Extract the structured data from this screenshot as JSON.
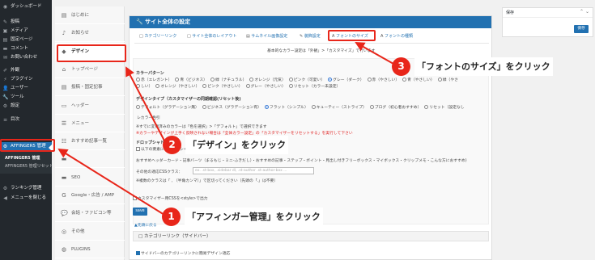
{
  "wp_menu": {
    "items": [
      {
        "label": "ダッシュボード",
        "icon": "dashboard-icon",
        "glyph": "◉"
      },
      {
        "label": "投稿",
        "icon": "pin-icon",
        "glyph": "✎"
      },
      {
        "label": "メディア",
        "icon": "media-icon",
        "glyph": "▣"
      },
      {
        "label": "固定ページ",
        "icon": "page-icon",
        "glyph": "▤"
      },
      {
        "label": "コメント",
        "icon": "comment-icon",
        "glyph": "▬"
      },
      {
        "label": "お問い合わせ",
        "icon": "mail-icon",
        "glyph": "✉"
      },
      {
        "label": "外観",
        "icon": "brush-icon",
        "glyph": "✐"
      },
      {
        "label": "プラグイン",
        "icon": "plugin-icon",
        "glyph": "⚡"
      },
      {
        "label": "ユーザー",
        "icon": "user-icon",
        "glyph": "👤"
      },
      {
        "label": "ツール",
        "icon": "wrench-icon",
        "glyph": "🔧"
      },
      {
        "label": "設定",
        "icon": "settings-icon",
        "glyph": "⚙"
      },
      {
        "label": "目次",
        "icon": "toc-icon",
        "glyph": "≡"
      },
      {
        "label": "AFFINGER5 管理",
        "icon": "gear-icon",
        "glyph": "⚙"
      },
      {
        "label": "ランキング管理",
        "icon": "ranking-icon",
        "glyph": "⚙"
      },
      {
        "label": "メニューを閉じる",
        "icon": "collapse-icon",
        "glyph": "◀"
      }
    ],
    "sub_items": [
      "AFFINGER5 管理",
      "AFFINGER5 管理リセット"
    ]
  },
  "tabs": [
    {
      "label": "はじめに",
      "icon": "book-icon",
      "glyph": "▤"
    },
    {
      "label": "お知らせ",
      "icon": "bell-icon",
      "glyph": "♪"
    },
    {
      "label": "デザイン",
      "icon": "diamond-icon",
      "glyph": "◆"
    },
    {
      "label": "トップページ",
      "icon": "home-icon",
      "glyph": "⌂"
    },
    {
      "label": "投稿・固定記事",
      "icon": "doc-icon",
      "glyph": "▤"
    },
    {
      "label": "ヘッダー",
      "icon": "header-icon",
      "glyph": "▭"
    },
    {
      "label": "メニュー",
      "icon": "menu-icon",
      "glyph": "☰"
    },
    {
      "label": "おすすめ記事一覧",
      "icon": "list-icon",
      "glyph": "☷"
    },
    {
      "label": "",
      "icon": "blank-icon",
      "glyph": "▬"
    },
    {
      "label": "SEO",
      "icon": "seo-icon",
      "glyph": "▬"
    },
    {
      "label": "Google・広告 / AMP",
      "icon": "google-icon",
      "glyph": "G"
    },
    {
      "label": "会話・ファビコン等",
      "icon": "chat-icon",
      "glyph": "💬"
    },
    {
      "label": "その他",
      "icon": "other-icon",
      "glyph": "◎"
    },
    {
      "label": "PLUGINS",
      "icon": "plugins-icon",
      "glyph": "◍"
    }
  ],
  "panel": {
    "title": "サイト全体の設定",
    "title_icon": "wrench-icon",
    "subnav": [
      {
        "prefix": "□",
        "label": "カテゴリーリンク"
      },
      {
        "prefix": "□",
        "label": "サイト全体のレイアウト"
      },
      {
        "prefix": "▤",
        "label": "サムネイル画像設定"
      },
      {
        "prefix": "✎",
        "label": "装飾設定"
      },
      {
        "prefix": "A",
        "label": "フォントのサイズ"
      },
      {
        "prefix": "A",
        "label": "フォントの種類"
      }
    ],
    "preset_note": "基本的なカラー設定は「外観」>「カスタマイズ」で行います",
    "color_pattern": {
      "heading": "カラーパターン",
      "row1": [
        "赤（エレガント）",
        "青（ビジネス）",
        "緑（ナチュラル）",
        "オレンジ（元気）",
        "ピンク（可愛い）",
        "グレー（ダーク）",
        "赤（やさしい）",
        "青（やさしい）",
        "緑（やさ"
      ],
      "row2": [
        "しい）",
        "オレンジ（やさしい）",
        "ピンク（やさしい）",
        "グレー（やさしい）",
        "リセット（カラー未設定）"
      ],
      "selected": "グレー（ダーク）"
    },
    "design_type": {
      "heading": "デザインタイプ（カスタマイザーの同期確認(リセット後)",
      "row1": [
        "デフォルト（グラデーション無）",
        "ビジネス（グラデーション有）",
        "フラット（シンプル）",
        "キューティー（ストライプ）",
        "ブログ（初心者おすすめ）",
        "リセット（設定なし"
      ],
      "row2": "レカラー色引",
      "selected": "フラット（シンプル）",
      "note1": "※すでに変更済みのカラーは「色を選択」>「デフォルト」で選択できます",
      "note2": "※カラーやデザインが上手く反映されない場合は「全体カラー設定」の「カスタマイザーをリセットする」を実行して下さい"
    },
    "dropdown": {
      "heading": "ドロップシャドウ",
      "checkbox_label": "以下の要素にドロップシャドウを追加します",
      "detail": "おすすめヘッダーカード・記事バーツ（まるもじ・ミニ-ふきだし）・おすすめの記事・ステップ・ボイント・見出し付きフリーボックス・マイボックス・クリップメモ・こんな方におすすめ)",
      "class_label": "その他の適応CSSクラス：",
      "class_placeholder": "ex. .st-box, .sidebar dl, .st-author .st-author-box ...",
      "class_note": "※複数のクラスは「 , （半角カンマ）」で区切ってください（先頭の「.」は不要）"
    },
    "customizer_chk": "カスタマイザー用CSSを<style>で出力",
    "save_label": "save",
    "to_top": "▲先頭に戻る",
    "section2_title": "カテゴリーリンク（サイドバー）",
    "section2_row": "サイドバーのカテゴリーリンクに簡易デザイン適応"
  },
  "savebox": {
    "title": "保存",
    "arrows": "⌃ ⌄",
    "button": "保存"
  },
  "annotations": [
    {
      "num": "1",
      "text": "「アフィンガー管理」をクリック"
    },
    {
      "num": "2",
      "text": "「デザイン」をクリック"
    },
    {
      "num": "3",
      "text": "「フォントのサイズ」をクリック"
    }
  ],
  "colors": {
    "accent": "#2271b1",
    "annotation_red": "#e8261a",
    "admin_bar": "#23282d"
  }
}
